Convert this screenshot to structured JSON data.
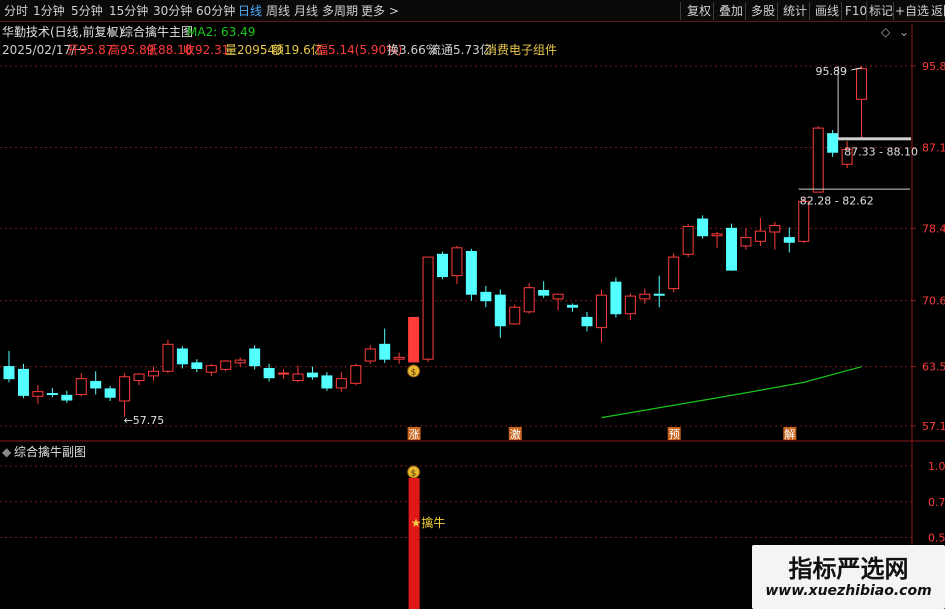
{
  "toolbar": {
    "left_items": [
      "分时",
      "1分钟",
      "5分钟",
      "15分钟",
      "30分钟",
      "60分钟",
      "日线",
      "周线",
      "月线",
      "多周期",
      "更多 >"
    ],
    "active": "日线",
    "right_items": [
      "复权",
      "叠加",
      "多股",
      "统计",
      "画线",
      "F10",
      "标记",
      "+自选",
      "返回"
    ]
  },
  "info": {
    "title": "华勤技术(日线,前复权)",
    "indicator": "综合擒牛主图",
    "ma_label": "MA2: 63.49",
    "date": "2025/02/17/一",
    "open": "开95.87",
    "high": "高95.89",
    "low": "低88.10",
    "close": "收92.31",
    "volume": "量209543",
    "amount": "额19.6亿",
    "change": "幅5.14(5.90%)",
    "turnover": "换3.66%",
    "float": "流通5.73亿",
    "sector": "消费电子组件"
  },
  "price_axis": [
    "95.89",
    "87.11",
    "78.4",
    "70.6",
    "63.5",
    "57.1"
  ],
  "sub_axis": [
    "1.00",
    "0.75",
    "0.50"
  ],
  "sub_panel": {
    "title": "综合擒牛副图",
    "star_label": "★擒牛"
  },
  "annotations": {
    "high_label": "95.89",
    "low_label": "←57.75",
    "range1": "87.33 - 88.10",
    "range2": "82.28 - 82.62"
  },
  "signals": [
    "涨",
    "激",
    "预",
    "解"
  ],
  "colors": {
    "up": "#ff3c3c",
    "down": "#54ffff",
    "ma": "#19c819",
    "grid": "#7a1a1a"
  },
  "watermark": {
    "title": "指标严选网",
    "url": "www.xuezhibiao.com"
  },
  "chart_data": {
    "type": "candlestick",
    "series": [
      {
        "o": 63.5,
        "h": 65.2,
        "l": 61.8,
        "c": 62.2
      },
      {
        "o": 63.2,
        "h": 63.8,
        "l": 60.1,
        "c": 60.4
      },
      {
        "o": 60.3,
        "h": 61.5,
        "l": 59.5,
        "c": 60.8
      },
      {
        "o": 60.6,
        "h": 61.2,
        "l": 60.2,
        "c": 60.5
      },
      {
        "o": 60.4,
        "h": 60.9,
        "l": 59.6,
        "c": 59.9
      },
      {
        "o": 60.5,
        "h": 62.8,
        "l": 60.3,
        "c": 62.2
      },
      {
        "o": 61.9,
        "h": 63.0,
        "l": 60.5,
        "c": 61.2
      },
      {
        "o": 61.1,
        "h": 61.4,
        "l": 59.8,
        "c": 60.2
      },
      {
        "o": 59.8,
        "h": 62.8,
        "l": 58.1,
        "c": 62.4
      },
      {
        "o": 62.0,
        "h": 62.8,
        "l": 61.5,
        "c": 62.7
      },
      {
        "o": 62.5,
        "h": 63.5,
        "l": 62.0,
        "c": 63.0
      },
      {
        "o": 63.0,
        "h": 66.4,
        "l": 62.8,
        "c": 65.9
      },
      {
        "o": 65.4,
        "h": 65.7,
        "l": 63.3,
        "c": 63.8
      },
      {
        "o": 63.9,
        "h": 64.3,
        "l": 62.9,
        "c": 63.3
      },
      {
        "o": 62.9,
        "h": 63.8,
        "l": 62.5,
        "c": 63.6
      },
      {
        "o": 63.2,
        "h": 64.2,
        "l": 63.0,
        "c": 64.1
      },
      {
        "o": 63.9,
        "h": 64.5,
        "l": 63.5,
        "c": 64.2
      },
      {
        "o": 65.4,
        "h": 65.8,
        "l": 63.2,
        "c": 63.6
      },
      {
        "o": 63.3,
        "h": 63.8,
        "l": 61.9,
        "c": 62.3
      },
      {
        "o": 62.7,
        "h": 63.2,
        "l": 62.2,
        "c": 62.8
      },
      {
        "o": 62.0,
        "h": 63.6,
        "l": 61.8,
        "c": 62.7
      },
      {
        "o": 62.8,
        "h": 63.5,
        "l": 62.1,
        "c": 62.4
      },
      {
        "o": 62.5,
        "h": 62.9,
        "l": 60.9,
        "c": 61.2
      },
      {
        "o": 61.2,
        "h": 62.9,
        "l": 60.8,
        "c": 62.2
      },
      {
        "o": 61.7,
        "h": 63.8,
        "l": 61.5,
        "c": 63.6
      },
      {
        "o": 64.1,
        "h": 65.8,
        "l": 63.8,
        "c": 65.4
      },
      {
        "o": 65.9,
        "h": 67.6,
        "l": 63.9,
        "c": 64.3
      },
      {
        "o": 64.3,
        "h": 65.0,
        "l": 63.8,
        "c": 64.5
      },
      {
        "o": 64.0,
        "h": 68.8,
        "l": 64.0,
        "c": 68.8
      },
      {
        "o": 64.3,
        "h": 75.3,
        "l": 64.0,
        "c": 75.3
      },
      {
        "o": 75.6,
        "h": 75.9,
        "l": 72.9,
        "c": 73.2
      },
      {
        "o": 73.3,
        "h": 76.5,
        "l": 72.4,
        "c": 76.3
      },
      {
        "o": 75.9,
        "h": 76.2,
        "l": 70.6,
        "c": 71.3
      },
      {
        "o": 71.5,
        "h": 72.2,
        "l": 69.9,
        "c": 70.6
      },
      {
        "o": 71.2,
        "h": 71.8,
        "l": 66.6,
        "c": 67.9
      },
      {
        "o": 68.1,
        "h": 70.2,
        "l": 68.0,
        "c": 69.9
      },
      {
        "o": 69.4,
        "h": 72.5,
        "l": 69.2,
        "c": 72.0
      },
      {
        "o": 71.7,
        "h": 72.7,
        "l": 70.9,
        "c": 71.2
      },
      {
        "o": 70.8,
        "h": 71.3,
        "l": 69.6,
        "c": 71.3
      },
      {
        "o": 70.1,
        "h": 70.3,
        "l": 69.4,
        "c": 69.9
      },
      {
        "o": 68.8,
        "h": 69.4,
        "l": 67.3,
        "c": 67.9
      },
      {
        "o": 67.7,
        "h": 71.8,
        "l": 66.1,
        "c": 71.2
      },
      {
        "o": 72.6,
        "h": 73.1,
        "l": 68.8,
        "c": 69.2
      },
      {
        "o": 69.2,
        "h": 71.4,
        "l": 68.5,
        "c": 71.1
      },
      {
        "o": 70.8,
        "h": 71.9,
        "l": 70.3,
        "c": 71.3
      },
      {
        "o": 71.3,
        "h": 73.3,
        "l": 69.9,
        "c": 71.2
      },
      {
        "o": 71.9,
        "h": 75.7,
        "l": 71.5,
        "c": 75.3
      },
      {
        "o": 75.6,
        "h": 78.9,
        "l": 75.3,
        "c": 78.6
      },
      {
        "o": 79.4,
        "h": 79.8,
        "l": 77.3,
        "c": 77.6
      },
      {
        "o": 77.6,
        "h": 78.0,
        "l": 76.3,
        "c": 77.8
      },
      {
        "o": 78.4,
        "h": 78.9,
        "l": 73.8,
        "c": 73.9
      },
      {
        "o": 76.5,
        "h": 78.4,
        "l": 76.1,
        "c": 77.4
      },
      {
        "o": 77.0,
        "h": 79.5,
        "l": 76.5,
        "c": 78.1
      },
      {
        "o": 78.0,
        "h": 79.1,
        "l": 76.1,
        "c": 78.7
      },
      {
        "o": 77.4,
        "h": 78.5,
        "l": 75.8,
        "c": 76.9
      },
      {
        "o": 77.0,
        "h": 81.6,
        "l": 76.8,
        "c": 81.3
      },
      {
        "o": 82.3,
        "h": 89.4,
        "l": 82.3,
        "c": 89.2
      },
      {
        "o": 88.6,
        "h": 89.0,
        "l": 86.1,
        "c": 86.6
      },
      {
        "o": 85.3,
        "h": 87.8,
        "l": 84.9,
        "c": 86.9
      },
      {
        "o": 92.3,
        "h": 95.9,
        "l": 88.1,
        "c": 95.6
      }
    ],
    "ma2_points": [
      [
        41,
        58.0
      ],
      [
        50,
        60.4
      ],
      [
        55,
        61.8
      ],
      [
        59,
        63.49
      ]
    ],
    "ylim": [
      57.1,
      95.89
    ]
  }
}
